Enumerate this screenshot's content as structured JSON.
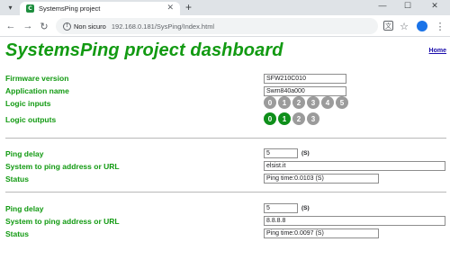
{
  "browser": {
    "tab_title": "SystemsPing project",
    "favicon_letter": "C",
    "close_glyph": "✕",
    "new_tab_glyph": "+",
    "tab_menu_glyph": "▾",
    "minimize_glyph": "—",
    "maximize_glyph": "☐",
    "close_window_glyph": "✕",
    "back_glyph": "←",
    "forward_glyph": "→",
    "reload_glyph": "↻",
    "security_label": "Non sicuro",
    "url": "192.168.0.181/SysPing/Index.html",
    "translate_glyph": "文",
    "star_glyph": "☆",
    "kebab_glyph": "⋮"
  },
  "header": {
    "title": "SystemsPing project dashboard",
    "home_link": "Home"
  },
  "device": {
    "firmware_label": "Firmware version",
    "firmware_value": "SFW210C010",
    "appname_label": "Application name",
    "appname_value": "Swm840a000",
    "inputs_label": "Logic inputs",
    "inputs": [
      "0",
      "1",
      "2",
      "3",
      "4",
      "5"
    ],
    "outputs_label": "Logic outputs",
    "outputs": [
      "0",
      "1",
      "2",
      "3"
    ]
  },
  "ping1": {
    "delay_label": "Ping delay",
    "delay_value": "5",
    "unit": "(S)",
    "address_label": "System to ping address or URL",
    "address_value": "elsist.it",
    "status_label": "Status",
    "status_value": "Ping time:0.0103 (S)"
  },
  "ping2": {
    "delay_label": "Ping delay",
    "delay_value": "5",
    "unit": "(S)",
    "address_label": "System to ping address or URL",
    "address_value": "8.8.8.8",
    "status_label": "Status",
    "status_value": "Ping time:0.0097 (S)"
  },
  "colors": {
    "accent_green": "#129a12",
    "led_on": "#0e8f1a",
    "led_off": "#9b9b9b"
  },
  "led_states": {
    "inputs_on": [
      false,
      false,
      false,
      false,
      false,
      false
    ],
    "outputs_on": [
      true,
      true,
      false,
      false
    ]
  }
}
